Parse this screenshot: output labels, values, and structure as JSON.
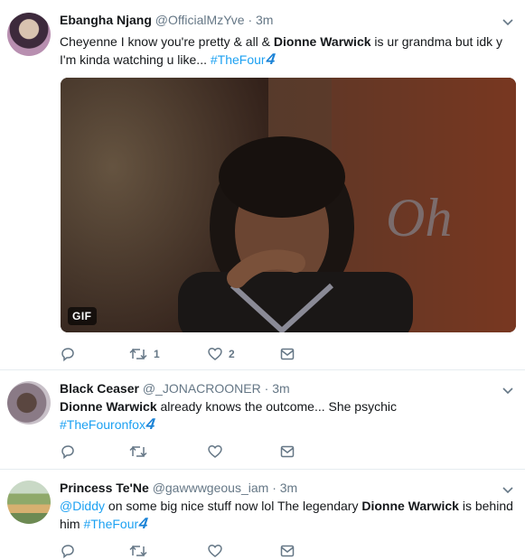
{
  "tweets": [
    {
      "name": "Ebangha Njang",
      "handle": "@OfficialMzYve",
      "dot": "·",
      "time": "3m",
      "text": {
        "l1_a": "Cheyenne I know you're pretty & all & ",
        "l1_b": "Dionne Warwick",
        "l1_c": " is ur grandma but idk y",
        "l2_a": "I'm kinda watching u like... ",
        "l2_tag": "#TheFour"
      },
      "media_badge": "GIF",
      "actions": {
        "replies": "",
        "retweets": "1",
        "likes": "2"
      }
    },
    {
      "name": "Black Ceaser",
      "handle": "@_JONACROONER",
      "dot": "·",
      "time": "3m",
      "text": {
        "l1_a": "Dionne Warwick",
        "l1_b": " already knows the outcome... She psychic",
        "l2_tag": "#TheFouronfox"
      },
      "actions": {
        "replies": "",
        "retweets": "",
        "likes": ""
      }
    },
    {
      "name": "Princess Te'Ne",
      "handle": "@gawwwgeous_iam",
      "dot": "·",
      "time": "3m",
      "text": {
        "l1_mention": "@Diddy",
        "l1_a": " on some big nice stuff now lol The legendary ",
        "l1_b": "Dionne Warwick",
        "l1_c": " is behind",
        "l2_a": "him ",
        "l2_tag": "#TheFour"
      }
    }
  ],
  "brand_mark": "4",
  "colors": {
    "link": "#1da1f2",
    "muted": "#657786",
    "border": "#e6ecf0"
  },
  "icons": [
    "reply-icon",
    "retweet-icon",
    "like-icon",
    "direct-message-icon",
    "chevron-down-icon"
  ]
}
